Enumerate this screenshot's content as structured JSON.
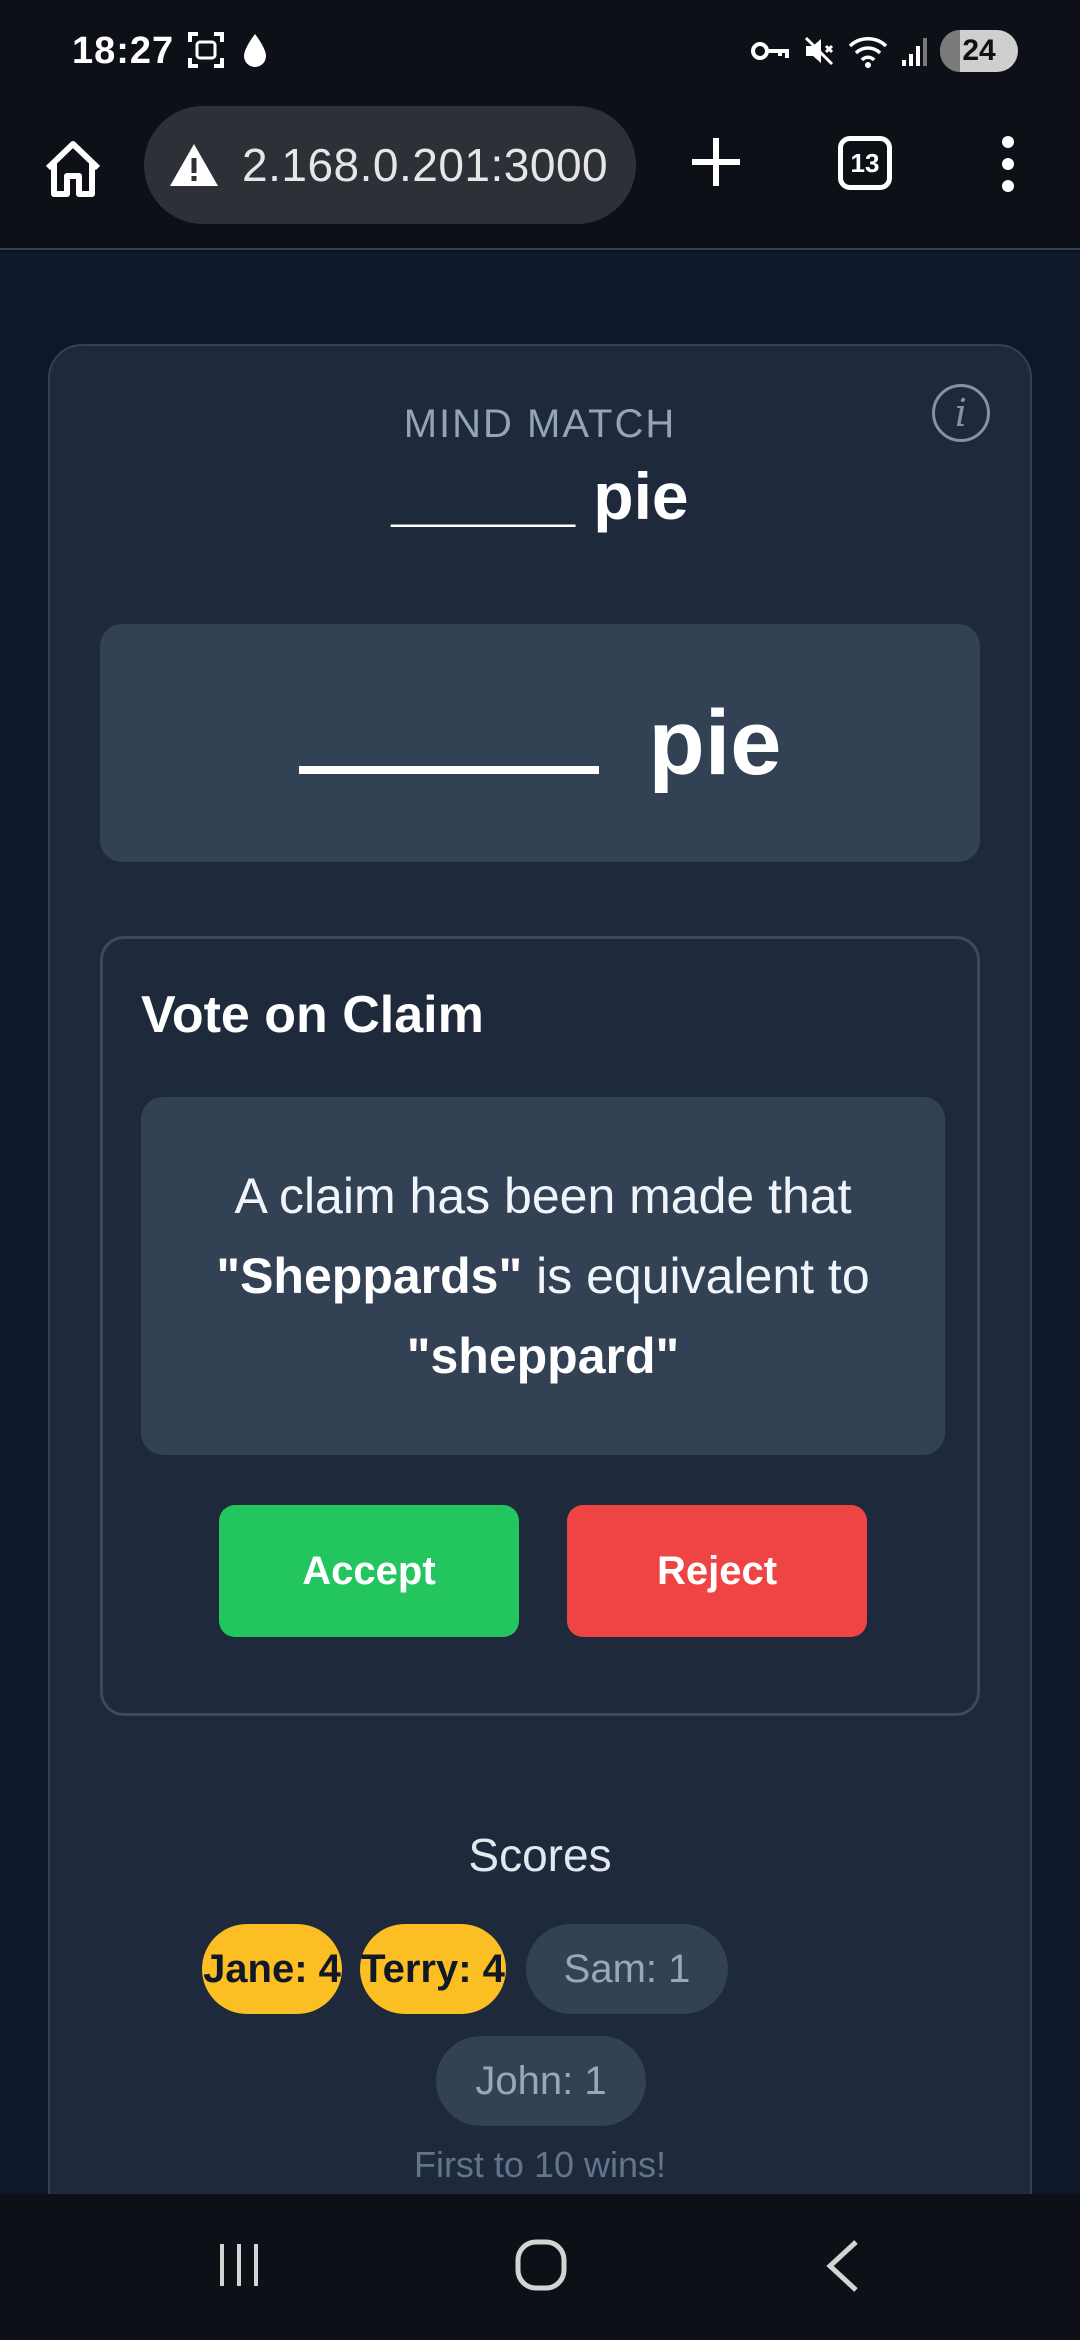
{
  "status_bar": {
    "time": "18:27",
    "battery": "24"
  },
  "browser": {
    "url": "2.168.0.201:3000",
    "tab_count": "13"
  },
  "game": {
    "app_title": "MIND MATCH",
    "prompt_word": "pie",
    "header_blank": "_____",
    "vote": {
      "title": "Vote on Claim",
      "claim_prefix": "A claim has been made that ",
      "claim_word": "\"Sheppards\"",
      "claim_middle": " is equivalent to ",
      "claim_target": "\"sheppard\"",
      "accept_label": "Accept",
      "reject_label": "Reject"
    },
    "scores_title": "Scores",
    "scores": [
      {
        "label": "Jane: 4",
        "leader": true
      },
      {
        "label": "Terry: 4",
        "leader": true
      },
      {
        "label": "Sam: 1",
        "leader": false
      },
      {
        "label": "John: 1",
        "leader": false
      }
    ],
    "footer": "First to 10 wins!"
  },
  "colors": {
    "accept": "#22c55e",
    "reject": "#ef4444",
    "leader_chip": "#fbbf24",
    "card": "#1e293b"
  }
}
